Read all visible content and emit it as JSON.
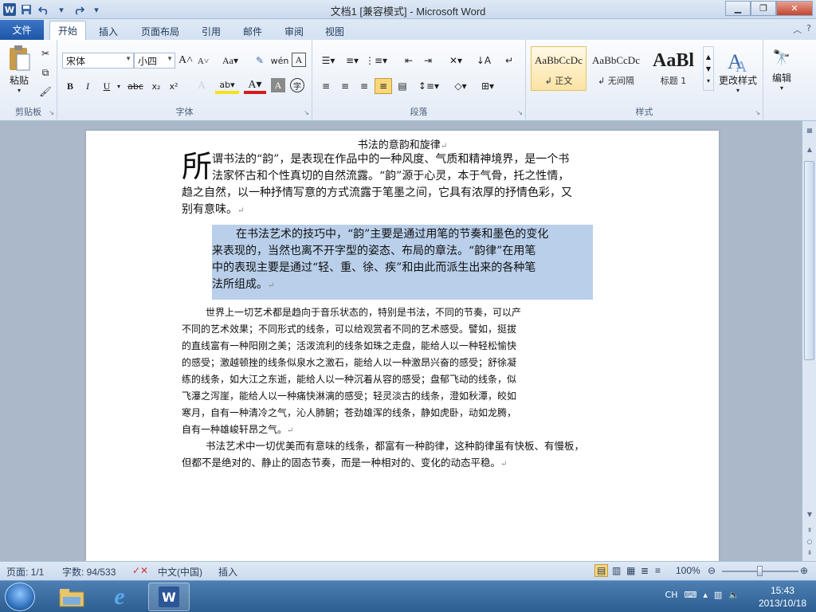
{
  "window": {
    "title": "文档1 [兼容模式] - Microsoft Word"
  },
  "qat": {
    "logo": "W",
    "save_icon": "save-icon",
    "undo_icon": "undo-icon",
    "redo_icon": "redo-icon"
  },
  "tabs": {
    "file": "文件",
    "items": [
      "开始",
      "插入",
      "页面布局",
      "引用",
      "邮件",
      "审阅",
      "视图"
    ]
  },
  "ribbon": {
    "clipboard": {
      "paste": "粘贴",
      "label": "剪贴板"
    },
    "font": {
      "name": "宋体",
      "size": "小四",
      "label": "字体",
      "grow": "A",
      "shrink": "A",
      "case": "Aa",
      "bold": "B",
      "italic": "I",
      "underline": "U",
      "strike": "abc",
      "sub": "x₂",
      "sup": "x²"
    },
    "paragraph": {
      "label": "段落"
    },
    "styles": {
      "label": "样式",
      "items": [
        {
          "preview": "AaBbCcDc",
          "name": "正文"
        },
        {
          "preview": "AaBbCcDc",
          "name": "无间隔"
        },
        {
          "preview": "AaBl",
          "name": "标题 1"
        }
      ],
      "change": "更改样式"
    },
    "editing": {
      "label": "编辑"
    }
  },
  "document": {
    "title": "书法的意韵和旋律",
    "dropcap": "所",
    "p1_lines": [
      "谓书法的“韵”，是表现在作品中的一种风度、气质和精神境界，是一个书",
      "法家怀古和个性真切的自然流露。“韵”源于心灵，本于气骨，托之性情，",
      "趋之自然，以一种抒情写意的方式流露于笔墨之间，它具有浓厚的抒情色彩，又",
      "别有意味。"
    ],
    "p2_lines": [
      "在书法艺术的技巧中，“韵”主要是通过用笔的节奏和墨色的变化",
      "来表现的，当然也离不开字型的姿态、布局的章法。“韵律”在用笔",
      "中的表现主要是通过“轻、重、徐、疾”和由此而派生出来的各种笔",
      "法所组成。"
    ],
    "p3_lines": [
      "世界上一切艺术都是趋向于音乐状态的，特别是书法，不同的节奏，可以产",
      "不同的艺术效果；不同形式的线条，可以给观赏者不同的艺术感受。譬如，挺拔",
      "的直线富有一种阳刚之美；活泼流利的线条如珠之走盘，能给人以一种轻松愉快",
      "的感受；激越顿挫的线条似泉水之激石，能给人以一种激昂兴奋的感受；舒徐凝",
      "练的线条，如大江之东逝，能给人以一种沉着从容的感受；盘郁飞动的线条，似",
      "飞瀑之泻崖，能给人以一种痛快淋漓的感受；轻灵淡古的线条，澄如秋潭，皎如",
      "寒月，自有一种清冷之气，沁人肺腑；苍劲雄浑的线条，静如虎卧，动如龙腾，",
      "自有一种雄峻轩昂之气。"
    ],
    "p4_lines": [
      "书法艺术中一切优美而有意味的线条，都富有一种韵律，这种韵律虽有快板、有慢板，",
      "但都不是绝对的、静止的固态节奏，而是一种相对的、变化的动态平稳。"
    ],
    "para_mark": "↵"
  },
  "status": {
    "page": "页面: 1/1",
    "words": "字数: 94/533",
    "lang": "中文(中国)",
    "mode": "插入",
    "zoom": "100%"
  },
  "taskbar": {
    "ime": "CH",
    "time": "15:43",
    "date": "2013/10/18"
  }
}
